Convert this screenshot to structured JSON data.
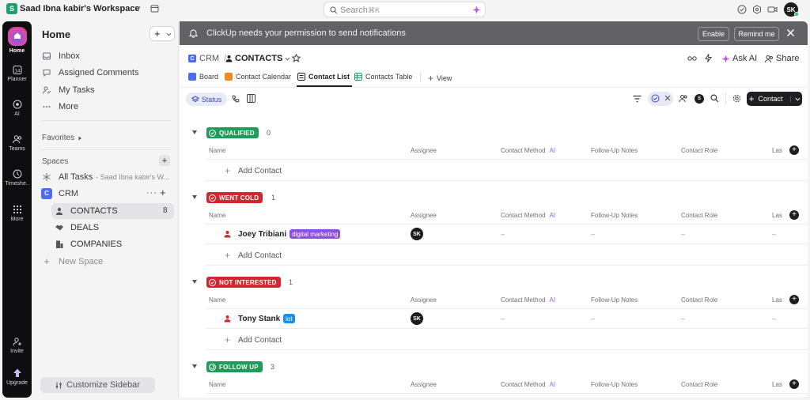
{
  "workspace": {
    "initial": "S",
    "name": "Saad Ibna kabir's Workspace"
  },
  "search": {
    "placeholder": "Search",
    "shortcut": "⌘K"
  },
  "user": {
    "initials": "SK"
  },
  "rail": {
    "home": "Home",
    "planner": "Planner",
    "ai": "AI",
    "teams": "Teams",
    "timesheets": "Timeshe..",
    "more": "More",
    "invite": "Invite",
    "upgrade": "Upgrade"
  },
  "sidebar": {
    "title": "Home",
    "items": [
      {
        "label": "Inbox",
        "icon": "inbox-icon"
      },
      {
        "label": "Assigned Comments",
        "icon": "comments-icon"
      },
      {
        "label": "My Tasks",
        "icon": "tasks-icon"
      },
      {
        "label": "More",
        "icon": "more-icon"
      }
    ],
    "favorites": "Favorites",
    "spaces": "Spaces",
    "all_tasks": "All Tasks",
    "all_tasks_sub": "- Saad Ibna kabir's W...",
    "crm": {
      "initial": "C",
      "label": "CRM"
    },
    "lists": [
      {
        "label": "CONTACTS",
        "count": "8"
      },
      {
        "label": "DEALS"
      },
      {
        "label": "COMPANIES"
      }
    ],
    "new_space": "New Space",
    "customize": "Customize Sidebar"
  },
  "notification": {
    "message": "ClickUp needs your permission to send notifications",
    "enable": "Enable",
    "remind": "Remind me"
  },
  "breadcrumb": {
    "space": "CRM",
    "list": "CONTACTS"
  },
  "header_actions": {
    "ask_ai": "Ask AI",
    "share": "Share"
  },
  "tabs": [
    {
      "label": "Board",
      "color": "#4a6cf7"
    },
    {
      "label": "Contact Calendar",
      "color": "#f08a24"
    },
    {
      "label": "Contact List",
      "color": "#1f1f23"
    },
    {
      "label": "Contacts Table",
      "color": "#1f9d6b"
    },
    {
      "label": "View"
    }
  ],
  "toolbar": {
    "status": "Status",
    "filter_user": "S",
    "contact_button": "Contact"
  },
  "columns": {
    "name": "Name",
    "assignee": "Assignee",
    "contact_method": "Contact Method",
    "ai": "AI",
    "notes": "Follow-Up Notes",
    "role": "Contact Role",
    "last": "Las"
  },
  "add_contact": "Add Contact",
  "groups": [
    {
      "label": "QUALIFIED",
      "count": "0",
      "color": "#1f9d58"
    },
    {
      "label": "WENT COLD",
      "count": "1",
      "color": "#d3262e",
      "row": {
        "name": "Joey Tribiani",
        "tag": "digital marketing",
        "tag_color": "#8e4fe0",
        "assignee": "SK"
      }
    },
    {
      "label": "NOT INTERESTED",
      "count": "1",
      "color": "#d3262e",
      "row": {
        "name": "Tony Stank",
        "tag": "iot",
        "tag_color": "#1d8cf0",
        "assignee": "SK"
      }
    },
    {
      "label": "FOLLOW UP",
      "count": "3",
      "color": "#1f9d58"
    }
  ],
  "empty_value": "–"
}
